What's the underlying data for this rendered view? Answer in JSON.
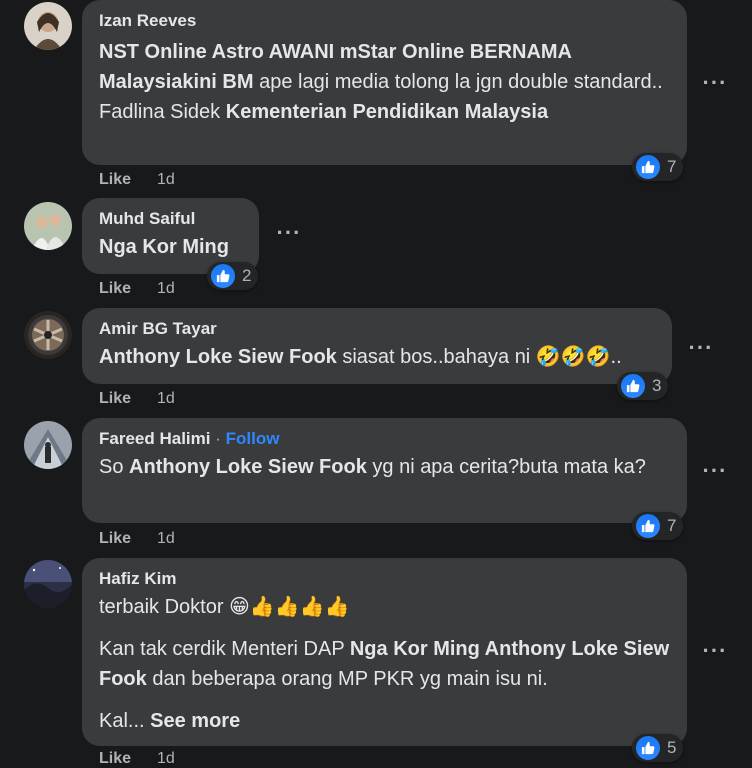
{
  "comments": [
    {
      "author": "Izan Reeves",
      "text_parts": [
        {
          "t": "NST Online Astro AWANI mStar Online BERNAMA Malaysiakini BM",
          "b": true
        },
        {
          "t": " ape lagi media tolong la jgn double standard.. Fadlina Sidek ",
          "b": false
        },
        {
          "t": "Kementerian Pendidikan Malaysia",
          "b": true
        }
      ],
      "reactions": "7",
      "like": "Like",
      "time": "1d"
    },
    {
      "author": "Muhd Saiful",
      "text_parts": [
        {
          "t": "Nga Kor Ming",
          "b": true
        }
      ],
      "reactions": "2",
      "like": "Like",
      "time": "1d"
    },
    {
      "author": "Amir BG Tayar",
      "text_parts": [
        {
          "t": "Anthony Loke Siew Fook",
          "b": true
        },
        {
          "t": " siasat bos..bahaya ni 🤣🤣🤣..",
          "b": false
        }
      ],
      "reactions": "3",
      "like": "Like",
      "time": "1d"
    },
    {
      "author": "Fareed Halimi",
      "follow": "Follow",
      "text_parts": [
        {
          "t": "So ",
          "b": false
        },
        {
          "t": "Anthony Loke Siew Fook",
          "b": true
        },
        {
          "t": " yg ni apa cerita?buta mata ka?",
          "b": false
        }
      ],
      "reactions": "7",
      "like": "Like",
      "time": "1d"
    },
    {
      "author": "Hafiz Kim",
      "line1": "terbaik Doktor 😁👍👍👍👍",
      "text_parts": [
        {
          "t": "Kan tak cerdik Menteri DAP ",
          "b": false
        },
        {
          "t": "Nga Kor Ming Anthony Loke Siew Fook",
          "b": true
        },
        {
          "t": " dan beberapa orang MP PKR yg main isu ni.",
          "b": false
        }
      ],
      "truncated": "Kal...",
      "see_more": "See more",
      "reactions": "5",
      "like": "Like",
      "time": "1d"
    }
  ],
  "icons": {
    "more": "more-options-icon",
    "like": "like-thumb-icon"
  },
  "colors": {
    "background": "#18191a",
    "bubble": "#3a3b3c",
    "link": "#2d88ff",
    "like_badge": "#1877f2"
  }
}
